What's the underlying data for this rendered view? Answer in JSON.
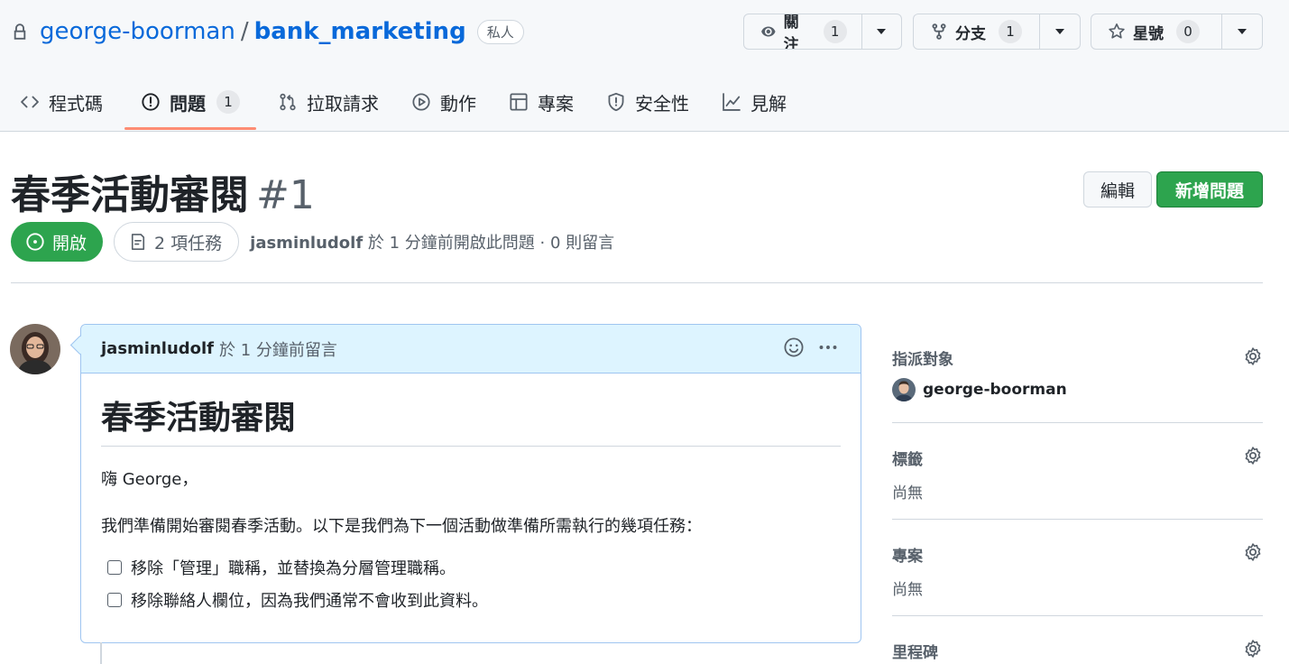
{
  "repo": {
    "owner": "george-boorman",
    "separator": "/",
    "name": "bank_marketing",
    "visibility": "私人"
  },
  "actions": {
    "watch": {
      "label": "關注",
      "count": "1"
    },
    "fork": {
      "label": "分支",
      "count": "1"
    },
    "star": {
      "label": "星號",
      "count": "0"
    }
  },
  "tabs": [
    {
      "label": "程式碼",
      "icon": "code-icon"
    },
    {
      "label": "問題",
      "icon": "issue-opened-icon",
      "count": "1",
      "active": true
    },
    {
      "label": "拉取請求",
      "icon": "git-pull-request-icon"
    },
    {
      "label": "動作",
      "icon": "play-icon"
    },
    {
      "label": "專案",
      "icon": "table-icon"
    },
    {
      "label": "安全性",
      "icon": "shield-icon"
    },
    {
      "label": "見解",
      "icon": "graph-icon"
    }
  ],
  "issue": {
    "title": "春季活動審閱",
    "number": "#1",
    "state": "開啟",
    "tasks": "2 項任務",
    "author": "jasminludolf",
    "meta": " 於 1 分鐘前開啟此問題 · 0 則留言",
    "edit_label": "編輯",
    "new_issue_label": "新增問題"
  },
  "comment": {
    "author": "jasminludolf",
    "time": "於 1 分鐘前留言",
    "heading": "春季活動審閱",
    "greeting": "嗨 George，",
    "intro": "我們準備開始審閱春季活動。以下是我們為下一個活動做準備所需執行的幾項任務：",
    "tasks": [
      {
        "text": "移除「管理」職稱，並替換為分層管理職稱。",
        "checked": false
      },
      {
        "text": "移除聯絡人欄位，因為我們通常不會收到此資料。",
        "checked": false
      }
    ]
  },
  "sidebar": {
    "assignees": {
      "title": "指派對象",
      "value": "george-boorman"
    },
    "labels": {
      "title": "標籤",
      "value": "尚無"
    },
    "projects": {
      "title": "專案",
      "value": "尚無"
    },
    "milestone": {
      "title": "里程碑"
    }
  },
  "colors": {
    "link": "#0969da",
    "open_green": "#2da44e",
    "active_tab_underline": "#fd8c73",
    "comment_header": "#ddf4ff"
  }
}
